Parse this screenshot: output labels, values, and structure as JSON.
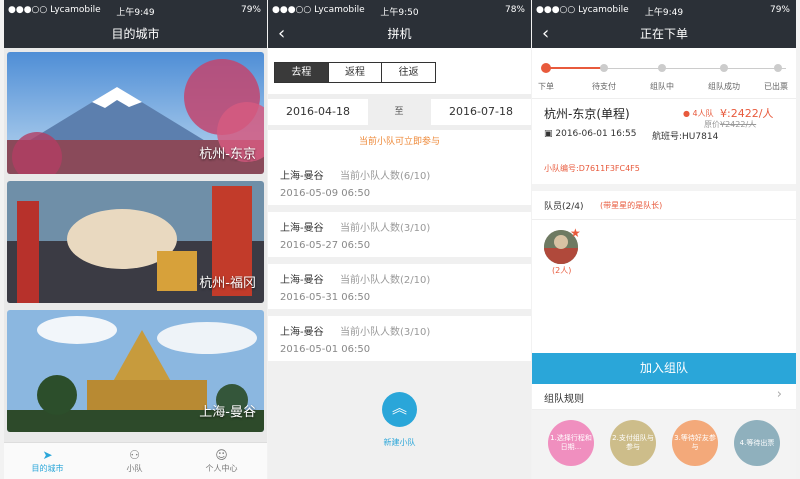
{
  "status": {
    "s1": {
      "carrier": "●●●○○ Lycamobile",
      "time": "上午9:49",
      "battery": "79%"
    },
    "s2": {
      "carrier": "●●●○○ Lycamobile",
      "time": "上午9:50",
      "battery": "78%"
    },
    "s3": {
      "carrier": "●●●○○ Lycamobile",
      "time": "上午9:49",
      "battery": "79%"
    }
  },
  "screen1": {
    "title": "目的城市",
    "cards": [
      {
        "label": "杭州-东京"
      },
      {
        "label": "杭州-福冈"
      },
      {
        "label": "上海-曼谷"
      }
    ],
    "tabs": [
      {
        "label": "目的城市",
        "icon": "➤"
      },
      {
        "label": "小队",
        "icon": "⚇"
      },
      {
        "label": "个人中心",
        "icon": "☺"
      }
    ]
  },
  "screen2": {
    "title": "拼机",
    "back": "‹",
    "segments": [
      "去程",
      "返程",
      "往返"
    ],
    "date_from": "2016-04-18",
    "date_sep": "至",
    "date_to": "2016-07-18",
    "hint": "当前小队可立即参与",
    "trips": [
      {
        "route": "上海-曼谷",
        "count": "当前小队人数(6/10)",
        "date": "2016-05-09 06:50"
      },
      {
        "route": "上海-曼谷",
        "count": "当前小队人数(3/10)",
        "date": "2016-05-27 06:50"
      },
      {
        "route": "上海-曼谷",
        "count": "当前小队人数(2/10)",
        "date": "2016-05-31 06:50"
      },
      {
        "route": "上海-曼谷",
        "count": "当前小队人数(3/10)",
        "date": "2016-05-01 06:50"
      }
    ],
    "fab_icon": "︽",
    "fab_label": "新建小队"
  },
  "screen3": {
    "title": "正在下单",
    "back": "‹",
    "steps_progress": [
      "下单",
      "待支付",
      "组队中",
      "组队成功",
      "已出票"
    ],
    "order_title": "杭州-东京(单程)",
    "team_badge": "4人队",
    "price": "¥:2422/人",
    "original_label": "原价",
    "original_price": "¥2422/人",
    "depart": "2016-06-01 16:55",
    "flight": "航班号:HU7814",
    "team_no": "小队编号:D7611F3FC4F5",
    "members_title": "队员(2/4)",
    "members_note": "(带星星的是队长)",
    "avatar_count": "(2人)",
    "join_label": "加入组队",
    "rules_label": "组队规则",
    "flow": [
      {
        "text": "1.选择行程和日期...",
        "color": "#f08fbf"
      },
      {
        "text": "2.支付组队与参与",
        "color": "#cdbd8a"
      },
      {
        "text": "3.等待好友参与",
        "color": "#f3a97a"
      },
      {
        "text": "4.等待出票",
        "color": "#8fb0bd"
      }
    ]
  }
}
